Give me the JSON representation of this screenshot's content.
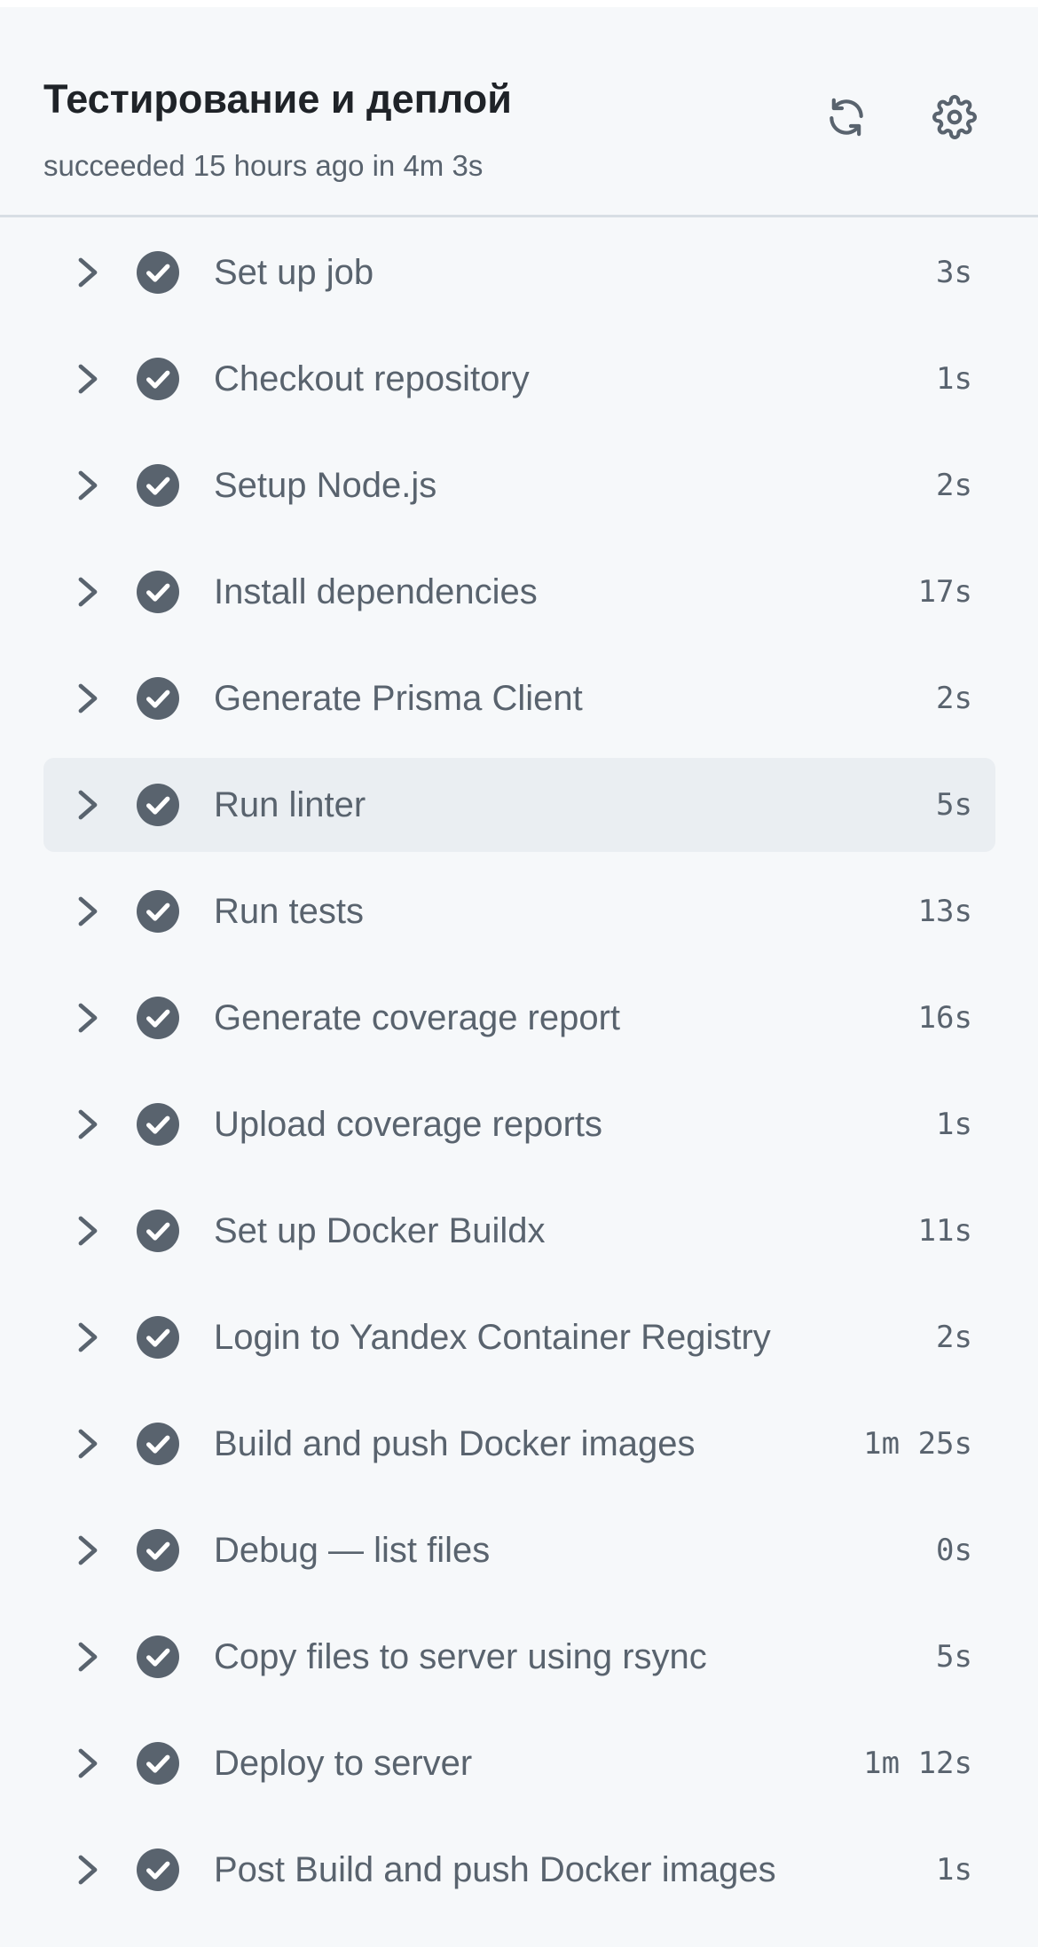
{
  "header": {
    "title": "Тестирование и деплой",
    "status": "succeeded 15 hours ago in 4m 3s",
    "refresh_icon": "refresh-icon",
    "settings_icon": "gear-icon"
  },
  "colors": {
    "background": "#f6f8fa",
    "text_primary": "#1f2328",
    "text_secondary": "#59636e",
    "success_icon": "#59636e",
    "active_row": "#eaeef2"
  },
  "steps": [
    {
      "name": "Set up job",
      "duration": "3s",
      "status": "success"
    },
    {
      "name": "Checkout repository",
      "duration": "1s",
      "status": "success"
    },
    {
      "name": "Setup Node.js",
      "duration": "2s",
      "status": "success"
    },
    {
      "name": "Install dependencies",
      "duration": "17s",
      "status": "success"
    },
    {
      "name": "Generate Prisma Client",
      "duration": "2s",
      "status": "success"
    },
    {
      "name": "Run linter",
      "duration": "5s",
      "status": "success",
      "active": true
    },
    {
      "name": "Run tests",
      "duration": "13s",
      "status": "success"
    },
    {
      "name": "Generate coverage report",
      "duration": "16s",
      "status": "success"
    },
    {
      "name": "Upload coverage reports",
      "duration": "1s",
      "status": "success"
    },
    {
      "name": "Set up Docker Buildx",
      "duration": "11s",
      "status": "success"
    },
    {
      "name": "Login to Yandex Container Registry",
      "duration": "2s",
      "status": "success"
    },
    {
      "name": "Build and push Docker images",
      "duration": "1m 25s",
      "status": "success"
    },
    {
      "name": "Debug — list files",
      "duration": "0s",
      "status": "success"
    },
    {
      "name": "Copy files to server using rsync",
      "duration": "5s",
      "status": "success"
    },
    {
      "name": "Deploy to server",
      "duration": "1m 12s",
      "status": "success"
    },
    {
      "name": "Post Build and push Docker images",
      "duration": "1s",
      "status": "success"
    }
  ]
}
